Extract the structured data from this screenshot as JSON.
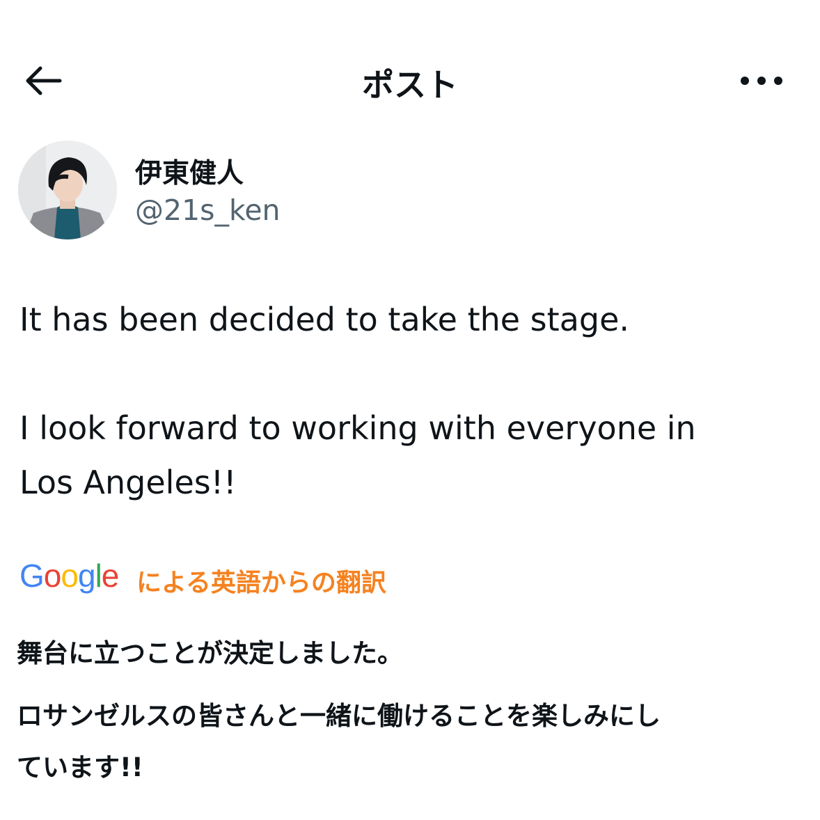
{
  "header": {
    "title": "ポスト"
  },
  "author": {
    "name": "伊東健人",
    "handle": "@21s_ken"
  },
  "post": {
    "lines": [
      "It has been decided to take the stage.",
      "I look forward to working with everyone in",
      "Los Angeles!!"
    ]
  },
  "translation": {
    "google_letters": [
      "G",
      "o",
      "o",
      "g",
      "l",
      "e"
    ],
    "google_colors": [
      "#4285F4",
      "#EA4335",
      "#FBBC05",
      "#4285F4",
      "#34A853",
      "#EA4335"
    ],
    "caption": "による英語からの翻訳",
    "caption_color": "#f58220",
    "lines": [
      "舞台に立つことが決定しました。",
      "ロサンゼルスの皆さんと一緒に働けることを楽しみにし",
      "ています!!"
    ]
  }
}
